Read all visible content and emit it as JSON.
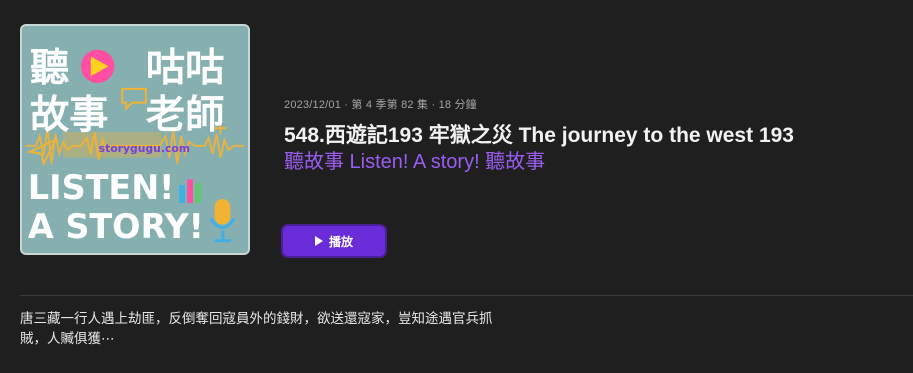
{
  "artwork": {
    "line1_left": "聽",
    "line1_right": "咕咕",
    "line2_left": "故事",
    "line2_right": "老師",
    "site": "storygugu.com",
    "line3": "LISTEN!",
    "line4": "A STORY!",
    "colors": {
      "background": "#86b0b0",
      "text": "#ffffff",
      "play_circle": "#ff4fa3",
      "play_triangle": "#ffd21f",
      "waveform": "#f2b233"
    }
  },
  "episode": {
    "meta": "2023/12/01 · 第 4 季第 82 集 · 18 分鐘",
    "title": "548.西遊記193 牢獄之災 The journey to the west 193",
    "show_name": "聽故事 Listen! A story! 聽故事"
  },
  "play_button": {
    "label": "播放",
    "icon": "play-icon",
    "color": "#6a2bd9"
  },
  "description": {
    "line1": "唐三藏一行人遇上劫匪，反倒奪回寇員外的錢財，欲送還寇家，豈知途遇官兵抓",
    "line2": "賊，人贓俱獲⋯"
  }
}
